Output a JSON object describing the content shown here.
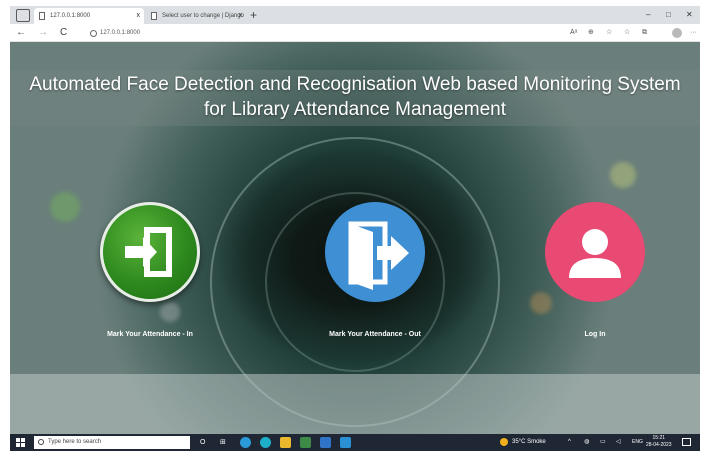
{
  "browser": {
    "tabs": [
      {
        "title": "127.0.0.1:8000",
        "close": "x"
      },
      {
        "title": "Select user to change | Django",
        "close": "x"
      }
    ],
    "new_tab": "+",
    "window": {
      "minimize": "–",
      "maximize": "□",
      "close": "✕"
    },
    "nav": {
      "back": "←",
      "forward": "→",
      "reload": "C"
    },
    "address": "127.0.0.1:8000",
    "tools": [
      "Aᵃ",
      "⊕",
      "☆",
      "☆",
      "⧉",
      "···"
    ]
  },
  "page": {
    "title_line1": "Automated Face Detection and Recognisation Web based Monitoring System",
    "title_line2": "for Library Attendance Management",
    "actions": [
      {
        "label": "Mark Your Attendance - In",
        "icon": "sign-in-icon",
        "color": "#2e8a1e"
      },
      {
        "label": "Mark Your Attendance - Out",
        "icon": "sign-out-icon",
        "color": "#3f8fd4"
      },
      {
        "label": "Log In",
        "icon": "user-icon",
        "color": "#e84a74"
      }
    ]
  },
  "taskbar": {
    "search_placeholder": "Type here to search",
    "weather": "35°C Smoke",
    "language": "ENG",
    "time": "15:21",
    "date": "28-04-2023"
  }
}
